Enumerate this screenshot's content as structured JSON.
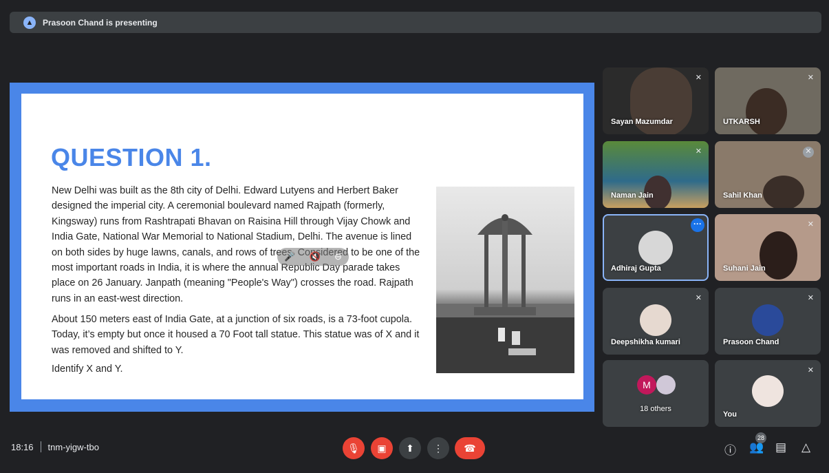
{
  "presenter": {
    "text": "Prasoon Chand is presenting"
  },
  "slide": {
    "title": "QUESTION 1.",
    "p1": "New Delhi was built as the 8th city of Delhi. Edward Lutyens and Herbert Baker designed the imperial city. A ceremonial boulevard named Rajpath (formerly, Kingsway) runs from Rashtrapati Bhavan on Raisina Hill through Vijay Chowk and India Gate, National War Memorial to National Stadium, Delhi. The avenue is lined on both sides by huge lawns, canals, and rows of trees. Considered to be one of the most important roads in India, it is where the annual Republic Day parade takes place on 26 January. Janpath (meaning \"People's Way\") crosses the road. Rajpath runs in an east-west direction.",
    "p2": "About 150 meters east of India Gate, at a junction of six roads, is a 73-foot cupola. Today, it’s empty but once it housed a 70 Foot tall statue. This statue was of X and it was removed and shifted to Y.",
    "p3": "Identify X and Y."
  },
  "participants": [
    {
      "name": "Sayan Mazumdar",
      "muted": true
    },
    {
      "name": "UTKARSH",
      "muted": true
    },
    {
      "name": "Naman Jain",
      "muted": true
    },
    {
      "name": "Sahil Khan",
      "muted": true
    },
    {
      "name": "Adhiraj Gupta",
      "muted": false
    },
    {
      "name": "Suhani Jain",
      "muted": true
    },
    {
      "name": "Deepshikha kumari",
      "muted": true
    },
    {
      "name": "Prasoon Chand",
      "muted": true
    },
    {
      "name": "18 others",
      "initial": "M"
    },
    {
      "name": "You",
      "muted": true
    }
  ],
  "footer": {
    "time": "18:16",
    "code": "tnm-yigw-tbo",
    "people_count": "28"
  },
  "icons": {
    "mic_off": "mic-off-icon",
    "cam_off": "camera-off-icon",
    "present": "present-screen-icon",
    "more": "more-vert-icon",
    "end_call": "end-call-icon",
    "info": "info-icon",
    "people": "people-icon",
    "chat": "chat-icon",
    "activities": "activities-icon"
  },
  "colors": {
    "end_call": "#ea4335",
    "slide_accent": "#4a86e8",
    "background": "#202124"
  }
}
